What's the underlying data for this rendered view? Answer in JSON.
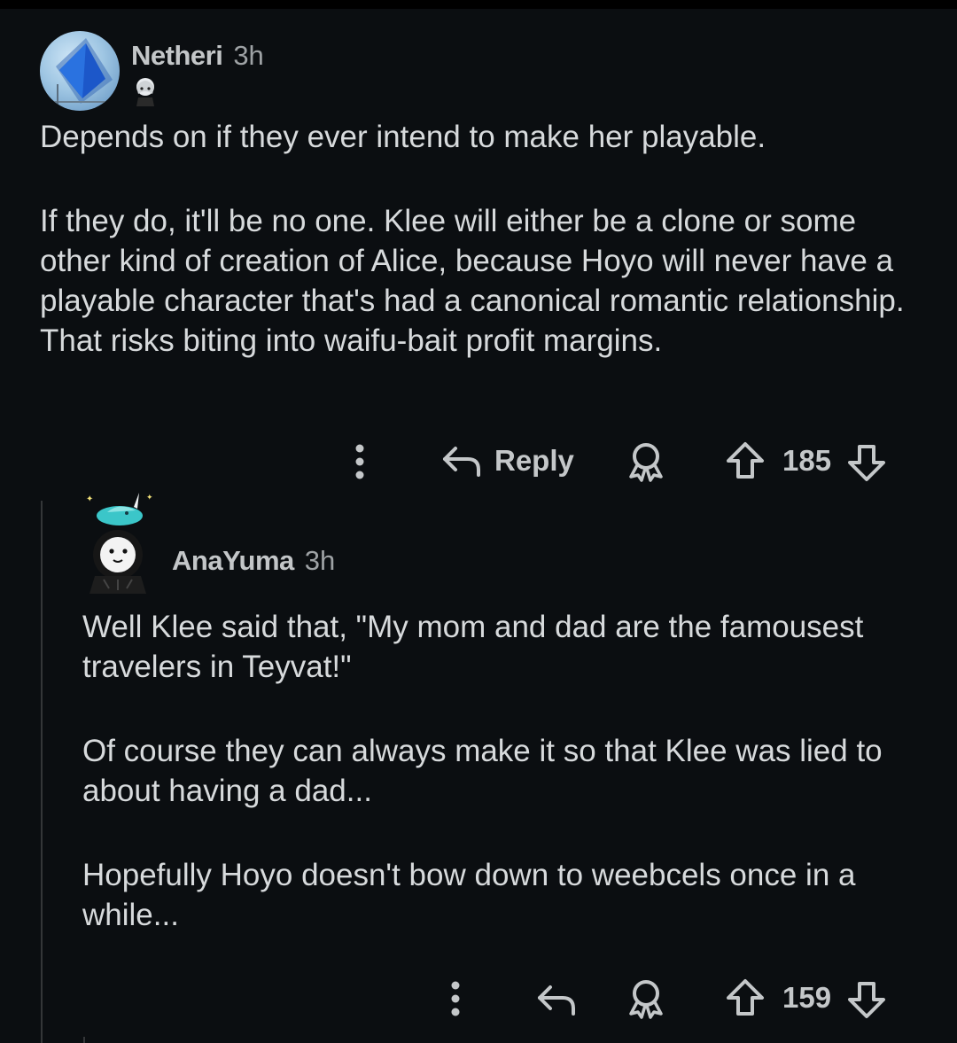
{
  "comments": [
    {
      "username": "Netheri",
      "time": "3h",
      "paragraphs": [
        "Depends on if they ever intend to make her playable.",
        "If they do, it'll be no one. Klee will either be a clone or some other kind of creation of Alice, because Hoyo will never have a playable character that's had a canonical romantic relationship. That risks biting into waifu-bait profit margins."
      ],
      "actions": {
        "more_icon": "more-vertical-icon",
        "reply_icon": "reply-arrow-icon",
        "reply_label": "Reply",
        "award_icon": "award-icon",
        "upvote_icon": "upvote-arrow-icon",
        "score": "185",
        "downvote_icon": "downvote-arrow-icon"
      }
    },
    {
      "username": "AnaYuma",
      "time": "3h",
      "paragraphs": [
        "Well Klee said that, \"My mom and dad are the famousest travelers in Teyvat!\"",
        "Of course they can always make it so that Klee was lied to about having a dad...",
        "Hopefully Hoyo doesn't bow down to weebcels once in a while..."
      ],
      "actions": {
        "more_icon": "more-vertical-icon",
        "reply_icon": "reply-arrow-icon",
        "award_icon": "award-icon",
        "upvote_icon": "upvote-arrow-icon",
        "score": "159",
        "downvote_icon": "downvote-arrow-icon"
      }
    }
  ],
  "colors": {
    "background": "#0b0e11",
    "text": "#d7dadc",
    "muted": "#9ea2a5",
    "thread_line": "#343638"
  }
}
